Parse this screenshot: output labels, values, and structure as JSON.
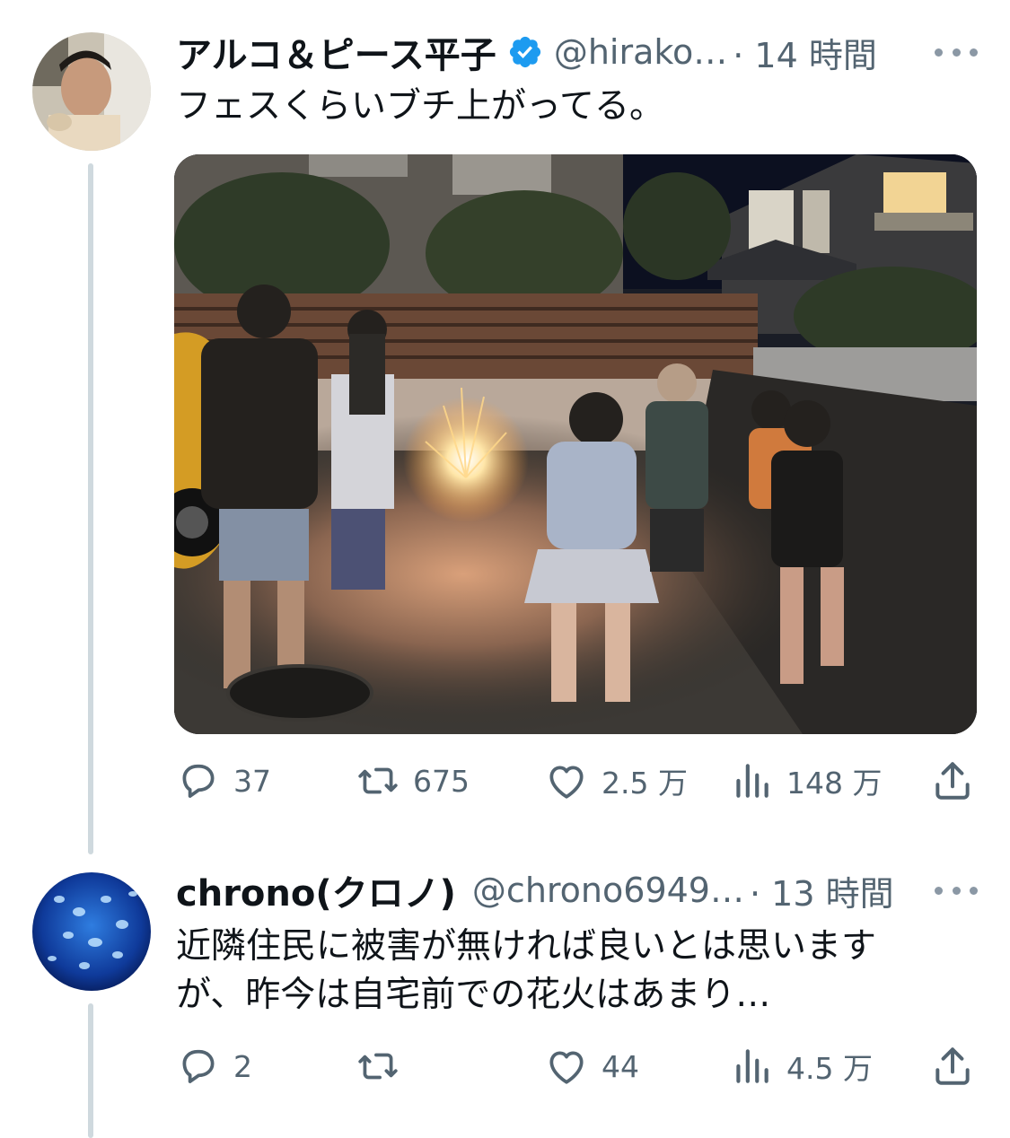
{
  "tweet1": {
    "display_name": "アルコ＆ピース平子",
    "handle": "@hirako…",
    "time": "· 14 時間",
    "text": "フェスくらいブチ上がってる。",
    "media_alt": "night-street-fireworks-photo",
    "stats": {
      "replies": "37",
      "retweets": "675",
      "likes": "2.5 万",
      "views": "148 万"
    }
  },
  "tweet2": {
    "display_name": "chrono(クロノ)",
    "handle": "@chrono6949…",
    "time": "· 13 時間",
    "text_line1": "近隣住民に被害が無ければ良いとは思います",
    "text_line2": "が、昨今は自宅前での花火はあまり…",
    "stats": {
      "replies": "2",
      "retweets": "",
      "likes": "44",
      "views": "4.5 万"
    }
  },
  "colors": {
    "verified": "#1d9bf0",
    "secondary_text": "#536471",
    "thread_line": "#cfd9de"
  }
}
